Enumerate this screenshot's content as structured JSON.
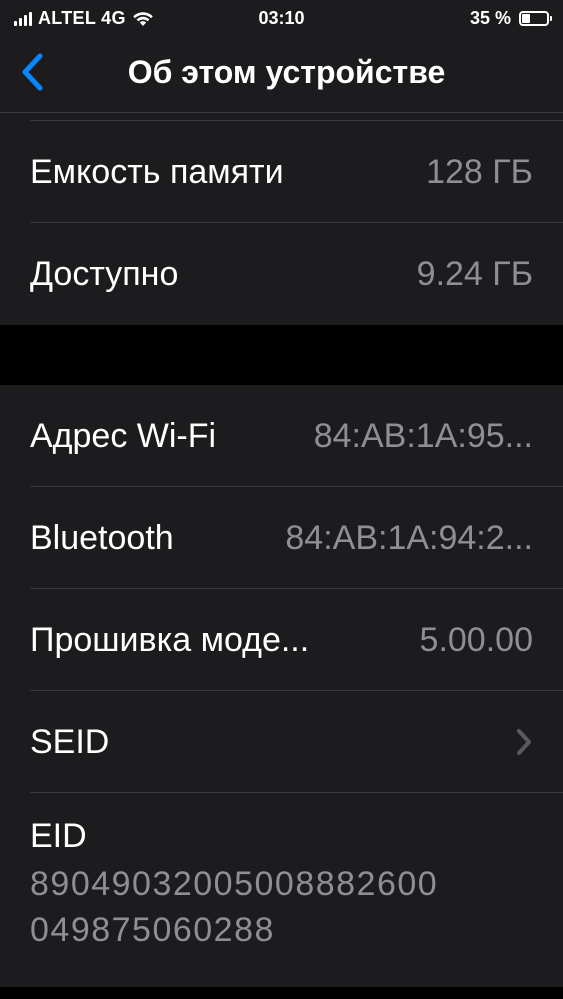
{
  "status_bar": {
    "carrier": "ALTEL 4G",
    "time": "03:10",
    "battery_percent": "35 %",
    "battery_level": 0.35,
    "icons": [
      "signal-bars-icon",
      "wifi-icon",
      "battery-icon"
    ]
  },
  "nav": {
    "title": "Об этом устройстве",
    "back_icon": "chevron-left-icon",
    "accent_color": "#0a84ff"
  },
  "storage": {
    "items": [
      {
        "label": "Емкость памяти",
        "value": "128 ГБ"
      },
      {
        "label": "Доступно",
        "value": "9.24 ГБ"
      }
    ]
  },
  "network": {
    "items": [
      {
        "label": "Адрес Wi-Fi",
        "value": "84:AB:1A:95..."
      },
      {
        "label": "Bluetooth",
        "value": "84:AB:1A:94:2..."
      },
      {
        "label": "Прошивка моде...",
        "value": "5.00.00"
      },
      {
        "label": "SEID",
        "value": "",
        "icon": "chevron-right-icon"
      }
    ],
    "eid": {
      "label": "EID",
      "value_line1": "89049032005008882600",
      "value_line2": "049875060288"
    }
  }
}
